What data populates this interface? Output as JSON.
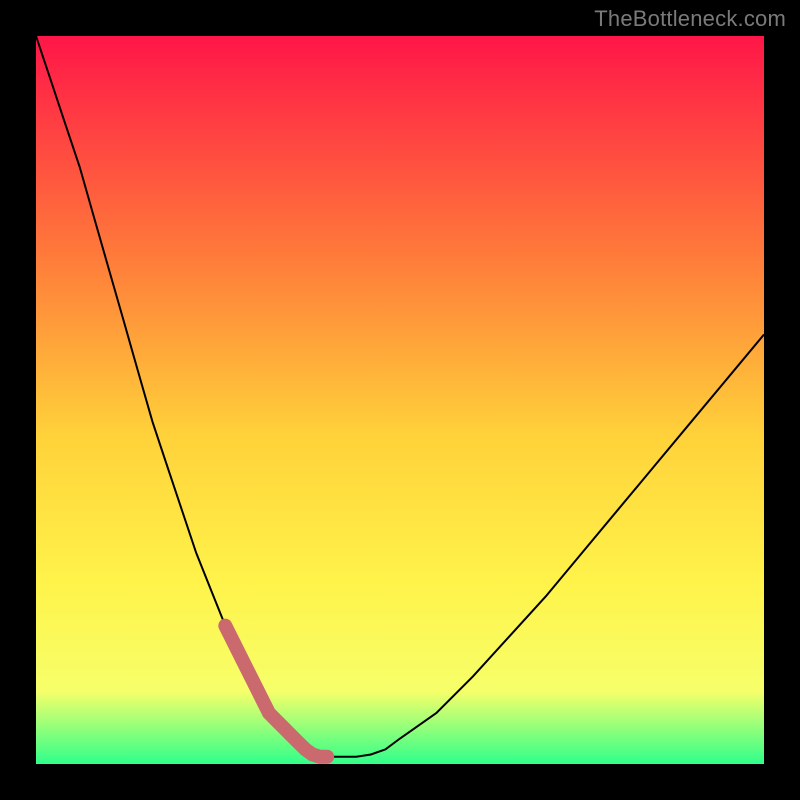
{
  "watermark": "TheBottleneck.com",
  "colors": {
    "accent_marker": "#cb6a6e",
    "curve": "#000000",
    "gradient_top": "#ff1648",
    "gradient_mid1": "#ff7a3a",
    "gradient_mid2": "#ffd23a",
    "gradient_mid3": "#fff34a",
    "gradient_bottom_yellow": "#f6ff6a",
    "gradient_green": "#2fff8a",
    "frame": "#000000"
  },
  "chart_data": {
    "type": "line",
    "title": "",
    "xlabel": "",
    "ylabel": "",
    "xlim": [
      0,
      100
    ],
    "ylim": [
      0,
      100
    ],
    "x": [
      0,
      2,
      4,
      6,
      8,
      10,
      12,
      14,
      16,
      18,
      20,
      22,
      24,
      26,
      28,
      30,
      32,
      33,
      34,
      35,
      36,
      37,
      38,
      39,
      40,
      42,
      44,
      46,
      48,
      50,
      55,
      60,
      65,
      70,
      75,
      80,
      85,
      90,
      95,
      100
    ],
    "values": [
      100,
      94,
      88,
      82,
      75,
      68,
      61,
      54,
      47,
      41,
      35,
      29,
      24,
      19,
      15,
      11,
      7,
      6,
      5,
      4,
      3,
      2,
      1.3,
      1,
      1,
      1,
      1,
      1.3,
      2,
      3.5,
      7,
      12,
      17.5,
      23,
      29,
      35,
      41,
      47,
      53,
      59
    ],
    "highlight_band_x": [
      26,
      40
    ],
    "annotations": [],
    "legend": []
  }
}
